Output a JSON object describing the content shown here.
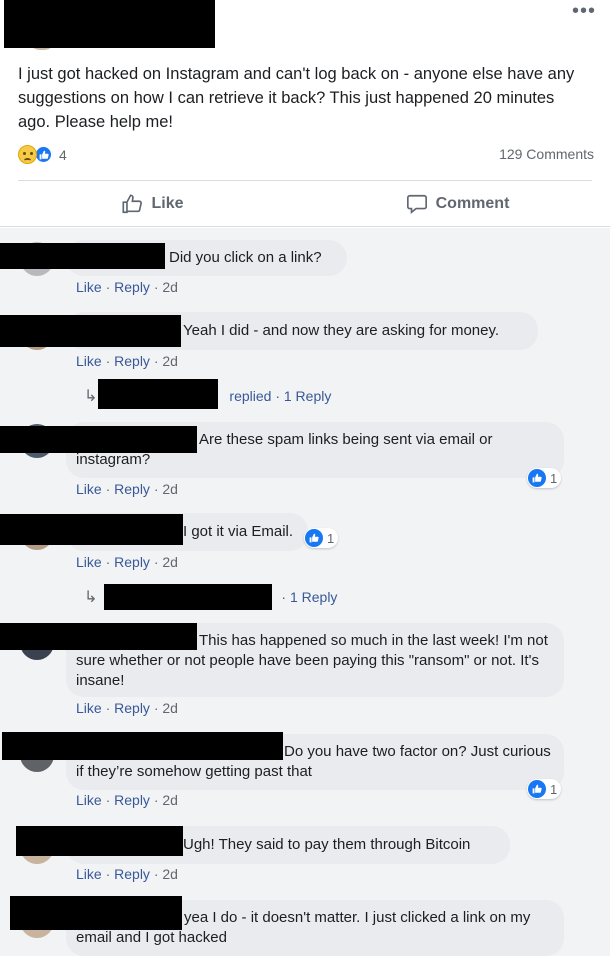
{
  "post": {
    "more_label": "•••",
    "text": "I just got hacked on Instagram and can't log back on - anyone else have any suggestions on how I can retrieve it back? This just happened 20 minutes ago. Please help me!",
    "reaction_count": "4",
    "comments_count": "129 Comments"
  },
  "actions": {
    "like": "Like",
    "comment": "Comment"
  },
  "meta": {
    "like": "Like",
    "sep": " · ",
    "reply": "Reply",
    "time": "2d"
  },
  "comments": [
    {
      "text": "Did you click on a link?"
    },
    {
      "text": "Yeah I did - and now they are asking for money."
    },
    {
      "text": "Are these spam links being sent via email or instagram?",
      "likes": "1"
    },
    {
      "text": "I got it via Email.",
      "likes": "1"
    },
    {
      "text": "This has happened so much in the last week! I'm not sure whether or not people have been paying this \"ransom\" or not. It's insane!"
    },
    {
      "text": "Do you have two factor on? Just curious if they’re somehow getting past that",
      "likes": "1"
    },
    {
      "text": "Ugh! They said to pay them through Bitcoin"
    },
    {
      "text": "yea I do - it doesn't matter. I just clicked a link on my email and I got hacked"
    }
  ],
  "replies": [
    {
      "text": "replied · 1 Reply"
    },
    {
      "text": "· 1 Reply"
    }
  ],
  "colors": {
    "link": "#385898",
    "like_blue": "#1877f2",
    "bubble": "#e9ebee",
    "muted": "#606770"
  }
}
